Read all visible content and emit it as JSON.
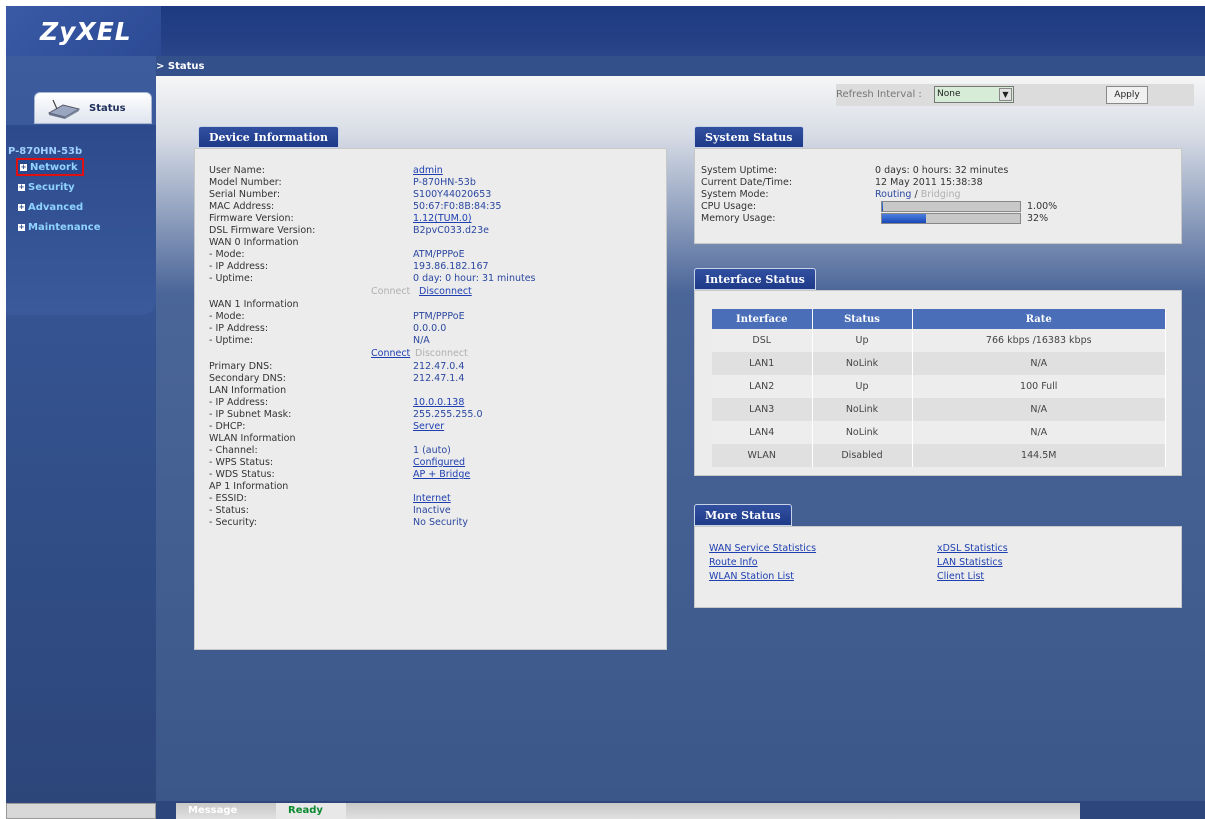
{
  "brand": {
    "logo": "ZyXEL"
  },
  "sidebar": {
    "status_tab": "Status",
    "model": "P-870HN-53b",
    "items": [
      {
        "label": "Network"
      },
      {
        "label": "Security"
      },
      {
        "label": "Advanced"
      },
      {
        "label": "Maintenance"
      }
    ]
  },
  "breadcrumb": "> Status",
  "refresh": {
    "label": "Refresh Interval :",
    "selected": "None",
    "apply": "Apply"
  },
  "device": {
    "title": "Device Information",
    "rows": [
      {
        "label": "User Name:",
        "value": "admin"
      },
      {
        "label": "Model Number:",
        "value": "P-870HN-53b"
      },
      {
        "label": "Serial Number:",
        "value": "S100Y44020653"
      },
      {
        "label": "MAC Address:",
        "value": "50:67:F0:8B:84:35"
      },
      {
        "label": "Firmware Version:",
        "value": "1.12(TUM.0)"
      },
      {
        "label": "DSL Firmware Version:",
        "value": "B2pvC033.d23e"
      },
      {
        "label": "WAN 0 Information",
        "value": ""
      },
      {
        "label": "- Mode:",
        "value": "ATM/PPPoE"
      },
      {
        "label": "- IP Address:",
        "value": "193.86.182.167"
      },
      {
        "label": "- Uptime:",
        "value": "0 day: 0 hour: 31 minutes"
      },
      {
        "label": "WAN 1 Information",
        "value": ""
      },
      {
        "label": "- Mode:",
        "value": "PTM/PPPoE"
      },
      {
        "label": "- IP Address:",
        "value": "0.0.0.0"
      },
      {
        "label": "- Uptime:",
        "value": "N/A"
      },
      {
        "label": "Primary DNS:",
        "value": "212.47.0.4"
      },
      {
        "label": "Secondary DNS:",
        "value": "212.47.1.4"
      },
      {
        "label": "LAN Information",
        "value": ""
      },
      {
        "label": "- IP Address:",
        "value": "10.0.0.138"
      },
      {
        "label": "- IP Subnet Mask:",
        "value": "255.255.255.0"
      },
      {
        "label": "- DHCP:",
        "value": "Server"
      },
      {
        "label": "WLAN Information",
        "value": ""
      },
      {
        "label": "- Channel:",
        "value": "1 (auto)"
      },
      {
        "label": "- WPS Status:",
        "value": "Configured"
      },
      {
        "label": "- WDS Status:",
        "value": "AP + Bridge"
      },
      {
        "label": "AP 1 Information",
        "value": ""
      },
      {
        "label": "- ESSID:",
        "value": "Internet"
      },
      {
        "label": "- Status:",
        "value": "Inactive"
      },
      {
        "label": "- Security:",
        "value": "No Security"
      }
    ],
    "wan0_connect": "Connect",
    "wan0_disconnect": "Disconnect",
    "wan1_connect": "Connect",
    "wan1_disconnect": "Disconnect"
  },
  "system": {
    "title": "System Status",
    "uptime_label": "System Uptime:",
    "uptime": "0 days: 0 hours: 32 minutes",
    "datetime_label": "Current Date/Time:",
    "datetime": "12 May 2011 15:38:38",
    "mode_label": "System Mode:",
    "mode_routing": "Routing",
    "mode_sep": " / ",
    "mode_bridging": "Bridging",
    "cpu_label": "CPU Usage:",
    "cpu_text": "1.00%",
    "cpu_fraction": 0.01,
    "mem_label": "Memory Usage:",
    "mem_text": "32%",
    "mem_fraction": 0.32
  },
  "interface": {
    "title": "Interface Status",
    "headers": [
      "Interface",
      "Status",
      "Rate"
    ],
    "rows": [
      [
        "DSL",
        "Up",
        "766 kbps /16383 kbps"
      ],
      [
        "LAN1",
        "NoLink",
        "N/A"
      ],
      [
        "LAN2",
        "Up",
        "100 Full"
      ],
      [
        "LAN3",
        "NoLink",
        "N/A"
      ],
      [
        "LAN4",
        "NoLink",
        "N/A"
      ],
      [
        "WLAN",
        "Disabled",
        "144.5M"
      ]
    ]
  },
  "more": {
    "title": "More Status",
    "links": [
      "WAN Service Statistics",
      "xDSL Statistics",
      "Route Info",
      "LAN Statistics",
      "WLAN Station List",
      "Client List"
    ]
  },
  "message": {
    "label": "Message",
    "value": "Ready"
  }
}
